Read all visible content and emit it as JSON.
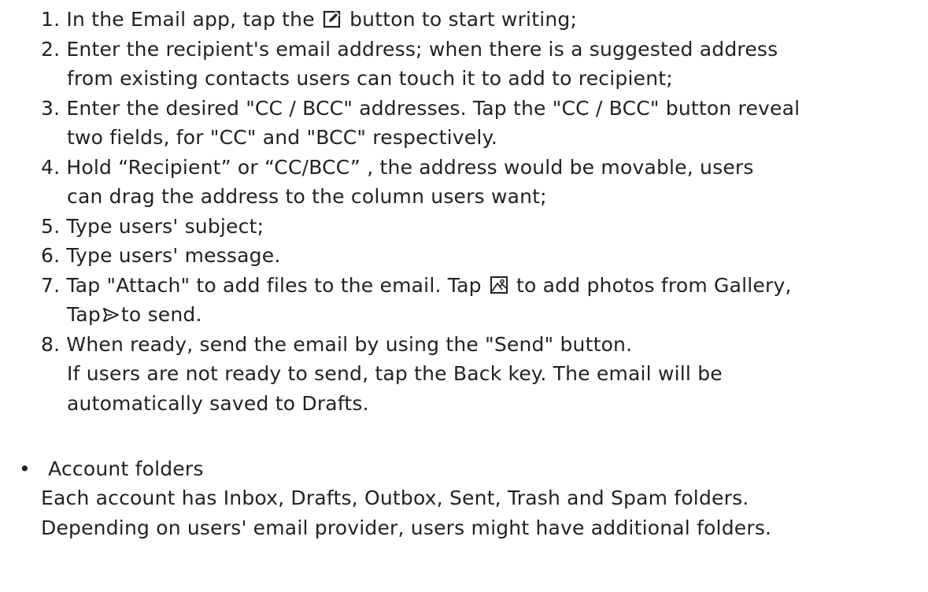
{
  "steps": [
    {
      "number": "1.",
      "lines": [
        {
          "before": "In the Email app, tap the",
          "icon": "compose-icon",
          "after": "button to start writing;"
        }
      ]
    },
    {
      "number": "2.",
      "lines": [
        {
          "text": "Enter the recipient's email address; when there is a suggested address"
        },
        {
          "text": "from existing contacts users can touch it to add to recipient;"
        }
      ]
    },
    {
      "number": "3.",
      "lines": [
        {
          "text": "Enter the desired \"CC / BCC\" addresses. Tap the \"CC / BCC\" button reveal"
        },
        {
          "text": "two fields, for \"CC\" and \"BCC\" respectively."
        }
      ]
    },
    {
      "number": "4.",
      "lines": [
        {
          "text": "Hold  “Recipient”  or  “CC/BCC” , the address would be movable, users"
        },
        {
          "text": "can drag the address to the column users want;"
        }
      ]
    },
    {
      "number": "5.",
      "lines": [
        {
          "text": "Type users' subject;"
        }
      ]
    },
    {
      "number": "6.",
      "lines": [
        {
          "text": "Type users' message."
        }
      ]
    },
    {
      "number": "7.",
      "lines": [
        {
          "before": "Tap \"Attach\" to add files to the email. Tap",
          "icon": "gallery-icon",
          "after": "to add photos from Gallery,"
        },
        {
          "before": "Tap",
          "icon": "send-icon",
          "after": "to send."
        }
      ]
    },
    {
      "number": "8.",
      "lines": [
        {
          "text": "When ready, send the email by using the \"Send\" button."
        },
        {
          "text": "If users are not ready to send, tap the Back key. The email will be"
        },
        {
          "text": "automatically saved to Drafts."
        }
      ]
    }
  ],
  "account_folders": {
    "bullet": "•",
    "title": "Account folders",
    "lines": [
      "Each account has Inbox, Drafts, Outbox, Sent, Trash and Spam folders.",
      "Depending on users' email provider, users might have additional folders."
    ]
  }
}
